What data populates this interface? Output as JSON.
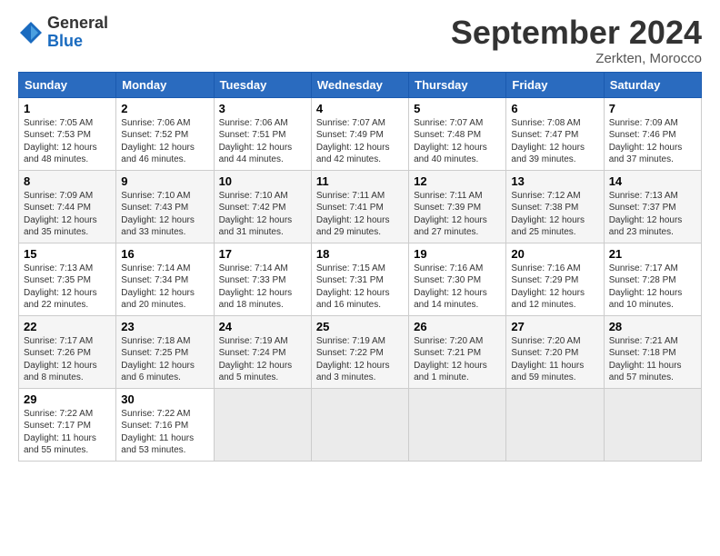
{
  "logo": {
    "general": "General",
    "blue": "Blue"
  },
  "header": {
    "month": "September 2024",
    "location": "Zerkten, Morocco"
  },
  "weekdays": [
    "Sunday",
    "Monday",
    "Tuesday",
    "Wednesday",
    "Thursday",
    "Friday",
    "Saturday"
  ],
  "weeks": [
    [
      {
        "day": "1",
        "lines": [
          "Sunrise: 7:05 AM",
          "Sunset: 7:53 PM",
          "Daylight: 12 hours",
          "and 48 minutes."
        ]
      },
      {
        "day": "2",
        "lines": [
          "Sunrise: 7:06 AM",
          "Sunset: 7:52 PM",
          "Daylight: 12 hours",
          "and 46 minutes."
        ]
      },
      {
        "day": "3",
        "lines": [
          "Sunrise: 7:06 AM",
          "Sunset: 7:51 PM",
          "Daylight: 12 hours",
          "and 44 minutes."
        ]
      },
      {
        "day": "4",
        "lines": [
          "Sunrise: 7:07 AM",
          "Sunset: 7:49 PM",
          "Daylight: 12 hours",
          "and 42 minutes."
        ]
      },
      {
        "day": "5",
        "lines": [
          "Sunrise: 7:07 AM",
          "Sunset: 7:48 PM",
          "Daylight: 12 hours",
          "and 40 minutes."
        ]
      },
      {
        "day": "6",
        "lines": [
          "Sunrise: 7:08 AM",
          "Sunset: 7:47 PM",
          "Daylight: 12 hours",
          "and 39 minutes."
        ]
      },
      {
        "day": "7",
        "lines": [
          "Sunrise: 7:09 AM",
          "Sunset: 7:46 PM",
          "Daylight: 12 hours",
          "and 37 minutes."
        ]
      }
    ],
    [
      {
        "day": "8",
        "lines": [
          "Sunrise: 7:09 AM",
          "Sunset: 7:44 PM",
          "Daylight: 12 hours",
          "and 35 minutes."
        ]
      },
      {
        "day": "9",
        "lines": [
          "Sunrise: 7:10 AM",
          "Sunset: 7:43 PM",
          "Daylight: 12 hours",
          "and 33 minutes."
        ]
      },
      {
        "day": "10",
        "lines": [
          "Sunrise: 7:10 AM",
          "Sunset: 7:42 PM",
          "Daylight: 12 hours",
          "and 31 minutes."
        ]
      },
      {
        "day": "11",
        "lines": [
          "Sunrise: 7:11 AM",
          "Sunset: 7:41 PM",
          "Daylight: 12 hours",
          "and 29 minutes."
        ]
      },
      {
        "day": "12",
        "lines": [
          "Sunrise: 7:11 AM",
          "Sunset: 7:39 PM",
          "Daylight: 12 hours",
          "and 27 minutes."
        ]
      },
      {
        "day": "13",
        "lines": [
          "Sunrise: 7:12 AM",
          "Sunset: 7:38 PM",
          "Daylight: 12 hours",
          "and 25 minutes."
        ]
      },
      {
        "day": "14",
        "lines": [
          "Sunrise: 7:13 AM",
          "Sunset: 7:37 PM",
          "Daylight: 12 hours",
          "and 23 minutes."
        ]
      }
    ],
    [
      {
        "day": "15",
        "lines": [
          "Sunrise: 7:13 AM",
          "Sunset: 7:35 PM",
          "Daylight: 12 hours",
          "and 22 minutes."
        ]
      },
      {
        "day": "16",
        "lines": [
          "Sunrise: 7:14 AM",
          "Sunset: 7:34 PM",
          "Daylight: 12 hours",
          "and 20 minutes."
        ]
      },
      {
        "day": "17",
        "lines": [
          "Sunrise: 7:14 AM",
          "Sunset: 7:33 PM",
          "Daylight: 12 hours",
          "and 18 minutes."
        ]
      },
      {
        "day": "18",
        "lines": [
          "Sunrise: 7:15 AM",
          "Sunset: 7:31 PM",
          "Daylight: 12 hours",
          "and 16 minutes."
        ]
      },
      {
        "day": "19",
        "lines": [
          "Sunrise: 7:16 AM",
          "Sunset: 7:30 PM",
          "Daylight: 12 hours",
          "and 14 minutes."
        ]
      },
      {
        "day": "20",
        "lines": [
          "Sunrise: 7:16 AM",
          "Sunset: 7:29 PM",
          "Daylight: 12 hours",
          "and 12 minutes."
        ]
      },
      {
        "day": "21",
        "lines": [
          "Sunrise: 7:17 AM",
          "Sunset: 7:28 PM",
          "Daylight: 12 hours",
          "and 10 minutes."
        ]
      }
    ],
    [
      {
        "day": "22",
        "lines": [
          "Sunrise: 7:17 AM",
          "Sunset: 7:26 PM",
          "Daylight: 12 hours",
          "and 8 minutes."
        ]
      },
      {
        "day": "23",
        "lines": [
          "Sunrise: 7:18 AM",
          "Sunset: 7:25 PM",
          "Daylight: 12 hours",
          "and 6 minutes."
        ]
      },
      {
        "day": "24",
        "lines": [
          "Sunrise: 7:19 AM",
          "Sunset: 7:24 PM",
          "Daylight: 12 hours",
          "and 5 minutes."
        ]
      },
      {
        "day": "25",
        "lines": [
          "Sunrise: 7:19 AM",
          "Sunset: 7:22 PM",
          "Daylight: 12 hours",
          "and 3 minutes."
        ]
      },
      {
        "day": "26",
        "lines": [
          "Sunrise: 7:20 AM",
          "Sunset: 7:21 PM",
          "Daylight: 12 hours",
          "and 1 minute."
        ]
      },
      {
        "day": "27",
        "lines": [
          "Sunrise: 7:20 AM",
          "Sunset: 7:20 PM",
          "Daylight: 11 hours",
          "and 59 minutes."
        ]
      },
      {
        "day": "28",
        "lines": [
          "Sunrise: 7:21 AM",
          "Sunset: 7:18 PM",
          "Daylight: 11 hours",
          "and 57 minutes."
        ]
      }
    ],
    [
      {
        "day": "29",
        "lines": [
          "Sunrise: 7:22 AM",
          "Sunset: 7:17 PM",
          "Daylight: 11 hours",
          "and 55 minutes."
        ]
      },
      {
        "day": "30",
        "lines": [
          "Sunrise: 7:22 AM",
          "Sunset: 7:16 PM",
          "Daylight: 11 hours",
          "and 53 minutes."
        ]
      },
      null,
      null,
      null,
      null,
      null
    ]
  ]
}
